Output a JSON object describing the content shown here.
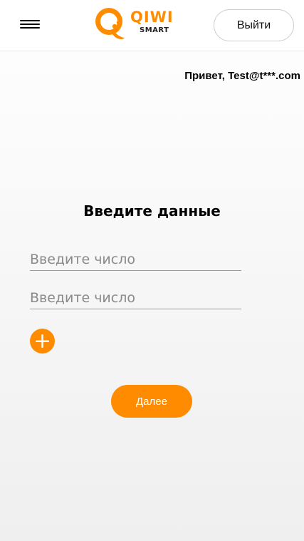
{
  "header": {
    "menu_icon": "hamburger-menu-icon",
    "logo": {
      "icon": "qiwi-logo-icon",
      "brand": "QIWI",
      "subtitle": "SMART",
      "color": "#ff8c00"
    },
    "logout_label": "Выйти"
  },
  "greeting": "Привет, Test@t***.com",
  "form": {
    "title": "Введите данные",
    "fields": [
      {
        "value": "",
        "placeholder": "Введите число"
      },
      {
        "value": "",
        "placeholder": "Введите число"
      }
    ],
    "add_icon": "plus-circle-icon",
    "next_label": "Далее"
  },
  "colors": {
    "accent": "#ff8c00",
    "text": "#000000",
    "placeholder": "#8a8a8a"
  }
}
